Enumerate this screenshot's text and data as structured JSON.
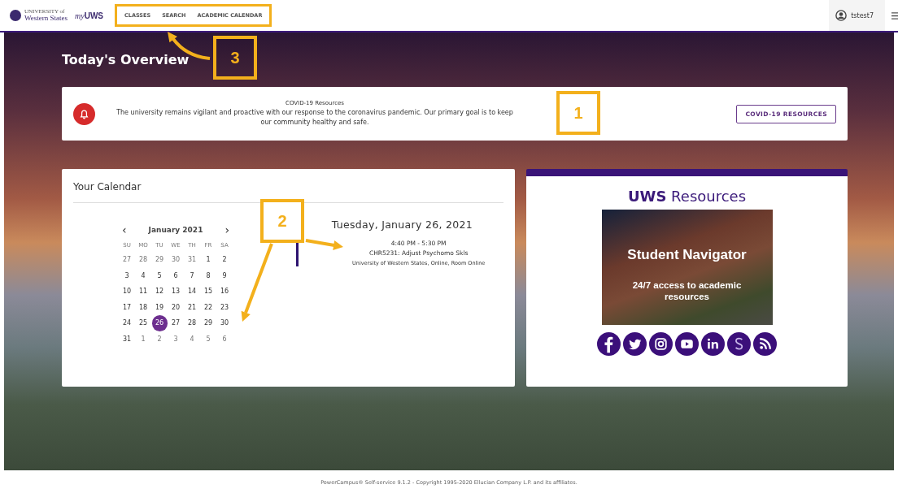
{
  "header": {
    "logo": {
      "small": "UNIVERSITY of",
      "name": "Western States",
      "app_prefix": "my",
      "app_name": "UWS"
    },
    "nav": [
      {
        "label": "CLASSES"
      },
      {
        "label": "SEARCH"
      },
      {
        "label": "ACADEMIC CALENDAR"
      }
    ],
    "user": {
      "name": "tstest7"
    }
  },
  "page_title": "Today's Overview",
  "alert": {
    "title": "COVID-19 Resources",
    "message": "The university remains vigilant and proactive with our response to the coronavirus pandemic. Our primary goal is to keep our community healthy and safe.",
    "button": "COVID-19 RESOURCES"
  },
  "calendar": {
    "title": "Your Calendar",
    "month": "January 2021",
    "prev": "‹",
    "next": "›",
    "weekdays": [
      "SU",
      "MO",
      "TU",
      "WE",
      "TH",
      "FR",
      "SA"
    ],
    "weeks": [
      [
        {
          "label": "27",
          "outside": true,
          "selected": false
        },
        {
          "label": "28",
          "outside": true,
          "selected": false
        },
        {
          "label": "29",
          "outside": true,
          "selected": false
        },
        {
          "label": "30",
          "outside": true,
          "selected": false
        },
        {
          "label": "31",
          "outside": true,
          "selected": false
        },
        {
          "label": "1",
          "outside": false,
          "selected": false
        },
        {
          "label": "2",
          "outside": false,
          "selected": false
        }
      ],
      [
        {
          "label": "3",
          "outside": false,
          "selected": false
        },
        {
          "label": "4",
          "outside": false,
          "selected": false
        },
        {
          "label": "5",
          "outside": false,
          "selected": false
        },
        {
          "label": "6",
          "outside": false,
          "selected": false
        },
        {
          "label": "7",
          "outside": false,
          "selected": false
        },
        {
          "label": "8",
          "outside": false,
          "selected": false
        },
        {
          "label": "9",
          "outside": false,
          "selected": false
        }
      ],
      [
        {
          "label": "10",
          "outside": false,
          "selected": false
        },
        {
          "label": "11",
          "outside": false,
          "selected": false
        },
        {
          "label": "12",
          "outside": false,
          "selected": false
        },
        {
          "label": "13",
          "outside": false,
          "selected": false
        },
        {
          "label": "14",
          "outside": false,
          "selected": false
        },
        {
          "label": "15",
          "outside": false,
          "selected": false
        },
        {
          "label": "16",
          "outside": false,
          "selected": false
        }
      ],
      [
        {
          "label": "17",
          "outside": false,
          "selected": false
        },
        {
          "label": "18",
          "outside": false,
          "selected": false
        },
        {
          "label": "19",
          "outside": false,
          "selected": false
        },
        {
          "label": "20",
          "outside": false,
          "selected": false
        },
        {
          "label": "21",
          "outside": false,
          "selected": false
        },
        {
          "label": "22",
          "outside": false,
          "selected": false
        },
        {
          "label": "23",
          "outside": false,
          "selected": false
        }
      ],
      [
        {
          "label": "24",
          "outside": false,
          "selected": false
        },
        {
          "label": "25",
          "outside": false,
          "selected": false
        },
        {
          "label": "26",
          "outside": false,
          "selected": true
        },
        {
          "label": "27",
          "outside": false,
          "selected": false
        },
        {
          "label": "28",
          "outside": false,
          "selected": false
        },
        {
          "label": "29",
          "outside": false,
          "selected": false
        },
        {
          "label": "30",
          "outside": false,
          "selected": false
        }
      ],
      [
        {
          "label": "31",
          "outside": false,
          "selected": false
        },
        {
          "label": "1",
          "outside": true,
          "selected": false
        },
        {
          "label": "2",
          "outside": true,
          "selected": false
        },
        {
          "label": "3",
          "outside": true,
          "selected": false
        },
        {
          "label": "4",
          "outside": true,
          "selected": false
        },
        {
          "label": "5",
          "outside": true,
          "selected": false
        },
        {
          "label": "6",
          "outside": true,
          "selected": false
        }
      ]
    ],
    "day_heading": "Tuesday, January 26, 2021",
    "events": [
      {
        "time": "4:40 PM - 5:30 PM",
        "course": "CHR5231: Adjust Psychomo Skls",
        "location": "University of Western States, Online, Room Online"
      }
    ]
  },
  "resources": {
    "title_bold": "UWS",
    "title_rest": "Resources",
    "banner": {
      "title": "Student Navigator",
      "subtitle": "24/7 access to academic resources"
    }
  },
  "callouts": [
    {
      "label": "3"
    },
    {
      "label": "1"
    },
    {
      "label": "2"
    }
  ],
  "footer": "PowerCampus® Self-service 9.1.2 - Copyright 1995-2020 Ellucian Company L.P. and its affiliates."
}
